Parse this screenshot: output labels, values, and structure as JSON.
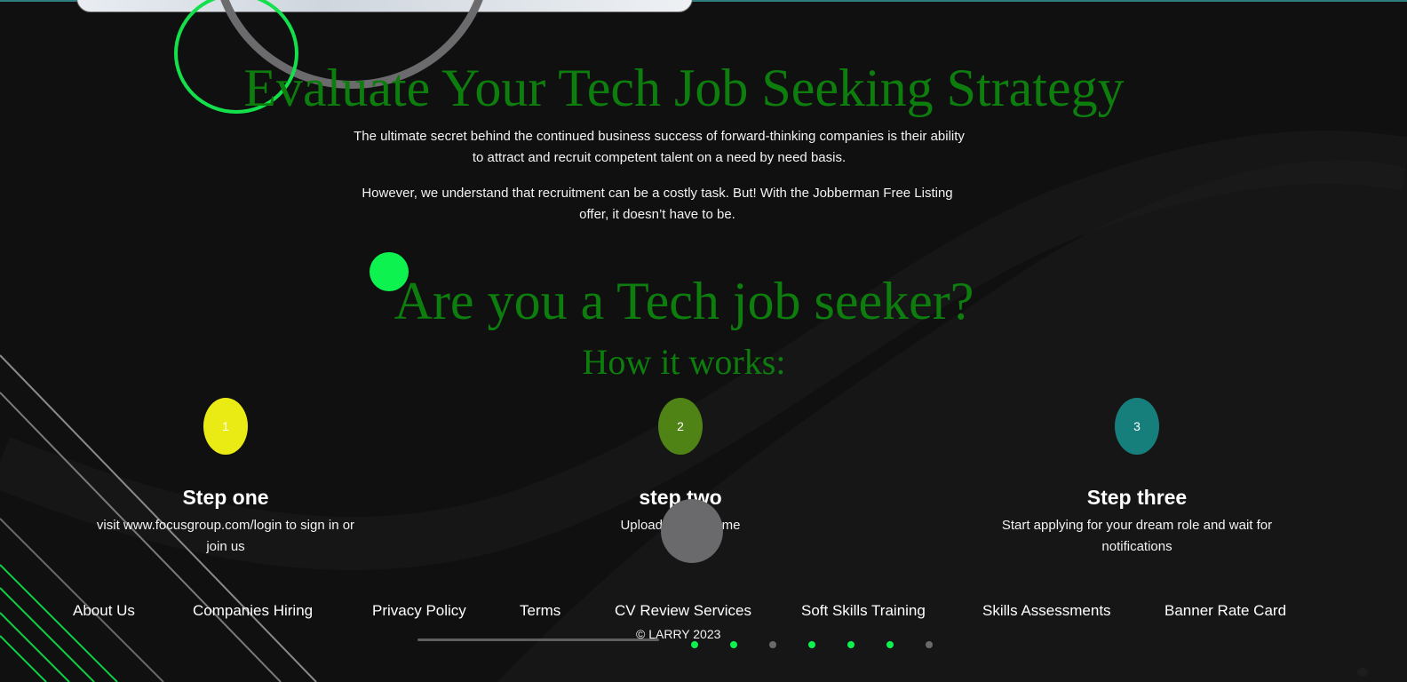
{
  "hero": {
    "title": "Evaluate Your Tech Job Seeking Strategy",
    "paragraph_1": "The ultimate secret behind the continued business success of forward-thinking companies is their ability to attract and recruit competent talent on a need by need basis.",
    "paragraph_2": "However, we understand that recruitment can be a costly task. But! With the Jobberman Free Listing offer, it doesn’t have to be."
  },
  "seeker": {
    "title": "Are you a Tech job seeker?",
    "subtitle": "How it works:"
  },
  "steps": [
    {
      "number": "1",
      "title": "Step one",
      "description": "visit www.focusgroup.com/login to sign in or join us",
      "color": "#eaeb14"
    },
    {
      "number": "2",
      "title": "step two",
      "description": "Upload your resume",
      "color": "#4f8316"
    },
    {
      "number": "3",
      "title": "Step three",
      "description": "Start applying for your dream role and wait for notifications",
      "color": "#167f7b"
    }
  ],
  "footer": {
    "links": [
      "About Us",
      "Companies Hiring",
      "Privacy Policy",
      "Terms",
      "CV Review Services",
      "Soft Skills Training",
      "Skills Assessments",
      "Banner Rate Card"
    ],
    "copyright": "© LARRY 2023"
  },
  "carousel": {
    "dot_states": [
      "active",
      "active",
      "inactive",
      "active",
      "active",
      "active",
      "inactive"
    ]
  },
  "colors": {
    "background": "#101011",
    "headline_green": "#0d7d0d",
    "accent_green": "#0ef24f",
    "gray_decor": "#6a6a6c"
  }
}
